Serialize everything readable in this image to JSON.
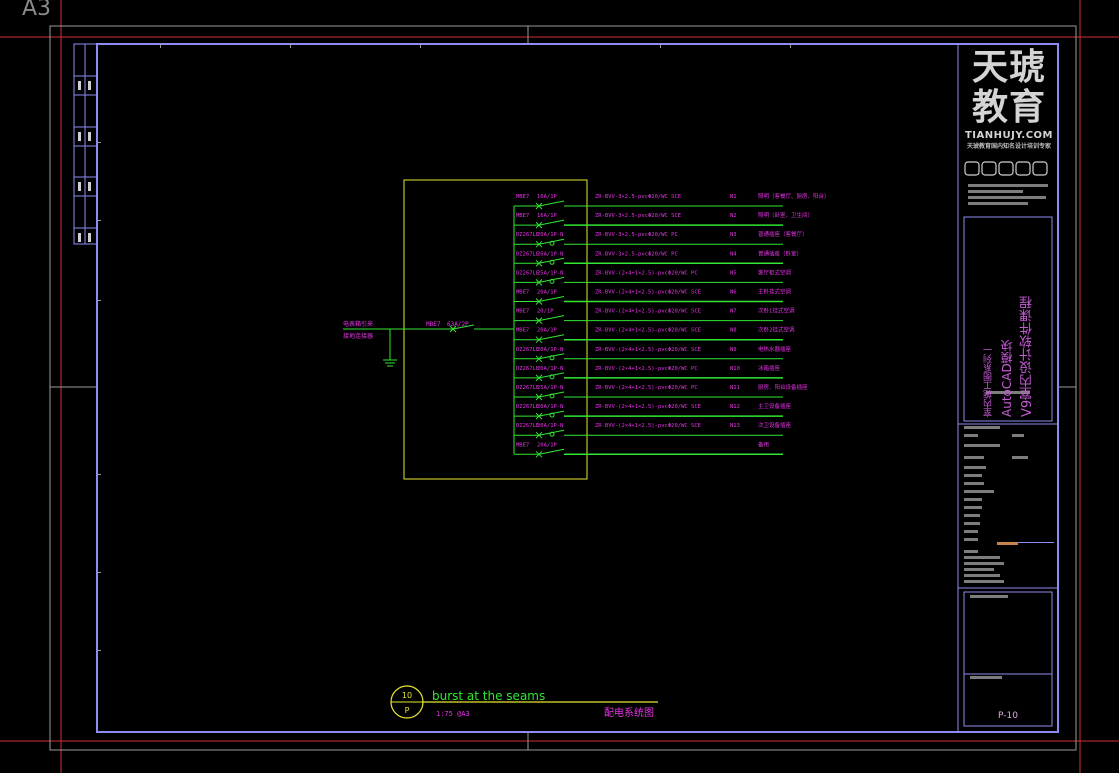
{
  "window": {
    "sheet_label": "A3"
  },
  "logo": {
    "line1": "天琥",
    "line2": "教育",
    "site": "TIANHUJY.COM",
    "slogan": "天琥教育国内知名设计培训专家"
  },
  "title_block": {
    "course": "V9室内设计软件课程",
    "module": "AutoCAD模块",
    "sheet_set": "室内施工图系列一",
    "page_number": "P-10"
  },
  "drawing": {
    "number": "10",
    "series": "P",
    "name": "burst at the seams",
    "scale_note": "1:75 @A3",
    "caption": "配电系统图"
  },
  "incoming": {
    "supply": "电表箱引来",
    "ground": "接地连接器",
    "main_breaker": "MBE7",
    "main_rating": "63A/2P"
  },
  "circuits": [
    {
      "breaker": "MBE7",
      "rating": "16A/1P",
      "cable": "ZR-BVV-3×2.5-pvcΦ20/WC SCE",
      "id": "N1",
      "load": "照明（客餐厅、厨房、阳台）"
    },
    {
      "breaker": "MBE7",
      "rating": "16A/1P",
      "cable": "ZR-BVV-3×2.5-pvcΦ20/WC SCE",
      "id": "N2",
      "load": "照明（卧室、卫生间）"
    },
    {
      "breaker": "DZ267LE",
      "rating": "20A/1P-N",
      "cable": "ZR-BVV-3×2.5-pvcΦ20/WC PC",
      "id": "N3",
      "load": "普通插座（客餐厅）"
    },
    {
      "breaker": "DZ267LE",
      "rating": "20A/1P-N",
      "cable": "ZR-BVV-3×2.5-pvcΦ20/WC PC",
      "id": "N4",
      "load": "普通插座（卧室）"
    },
    {
      "breaker": "DZ267LE",
      "rating": "25A/1P-N",
      "cable": "ZR-BVV-(2×4+1×2.5)-pvcΦ20/WC PC",
      "id": "N5",
      "load": "客厅柜式空调"
    },
    {
      "breaker": "MBE7",
      "rating": "20A/1P",
      "cable": "ZR-BVV-(2×4+1×2.5)-pvcΦ20/WC SCE",
      "id": "N6",
      "load": "主卧挂式空调"
    },
    {
      "breaker": "MBE7",
      "rating": "20/1P",
      "cable": "ZR-BVV-(2×4+1×2.5)-pvcΦ20/WC SCE",
      "id": "N7",
      "load": "次卧1挂式空调"
    },
    {
      "breaker": "MBE7",
      "rating": "20A/1P",
      "cable": "ZR-BVV-(2×4+1×2.5)-pvcΦ20/WC SCE",
      "id": "N8",
      "load": "次卧2挂式空调"
    },
    {
      "breaker": "DZ267LE",
      "rating": "20A/1P-N",
      "cable": "ZR-BVV-(2×4+1×2.5)-pvcΦ20/WC SCE",
      "id": "N9",
      "load": "电热水器插座"
    },
    {
      "breaker": "DZ267LE",
      "rating": "20A/1P-N",
      "cable": "ZR-BVV-(2×4+1×2.5)-pvcΦ20/WC PC",
      "id": "N10",
      "load": "冰箱插座"
    },
    {
      "breaker": "DZ267LE",
      "rating": "25A/1P-N",
      "cable": "ZR-BVV-(2×4+1×2.5)-pvcΦ20/WC PC",
      "id": "N11",
      "load": "厨房、阳台设备插座"
    },
    {
      "breaker": "DZ267LE",
      "rating": "20A/1P-N",
      "cable": "ZR-BVV-(2×4+1×2.5)-pvcΦ20/WC SCE",
      "id": "N12",
      "load": "主卫设备插座"
    },
    {
      "breaker": "DZ267LE",
      "rating": "20A/1P-N",
      "cable": "ZR-BVV-(2×4+1×2.5)-pvcΦ20/WC SCE",
      "id": "N13",
      "load": "次卫设备插座"
    },
    {
      "breaker": "MBE7",
      "rating": "20A/1P",
      "cable": "",
      "id": "",
      "load": "备用"
    }
  ],
  "colors": {
    "background": "#000000",
    "frame": "#8c8cf2",
    "panel_outline": "#e6e632",
    "circuit": "#32e632",
    "label": "#e632e6",
    "accent_bar": "#c8824a",
    "crosshair": "#d23232"
  }
}
